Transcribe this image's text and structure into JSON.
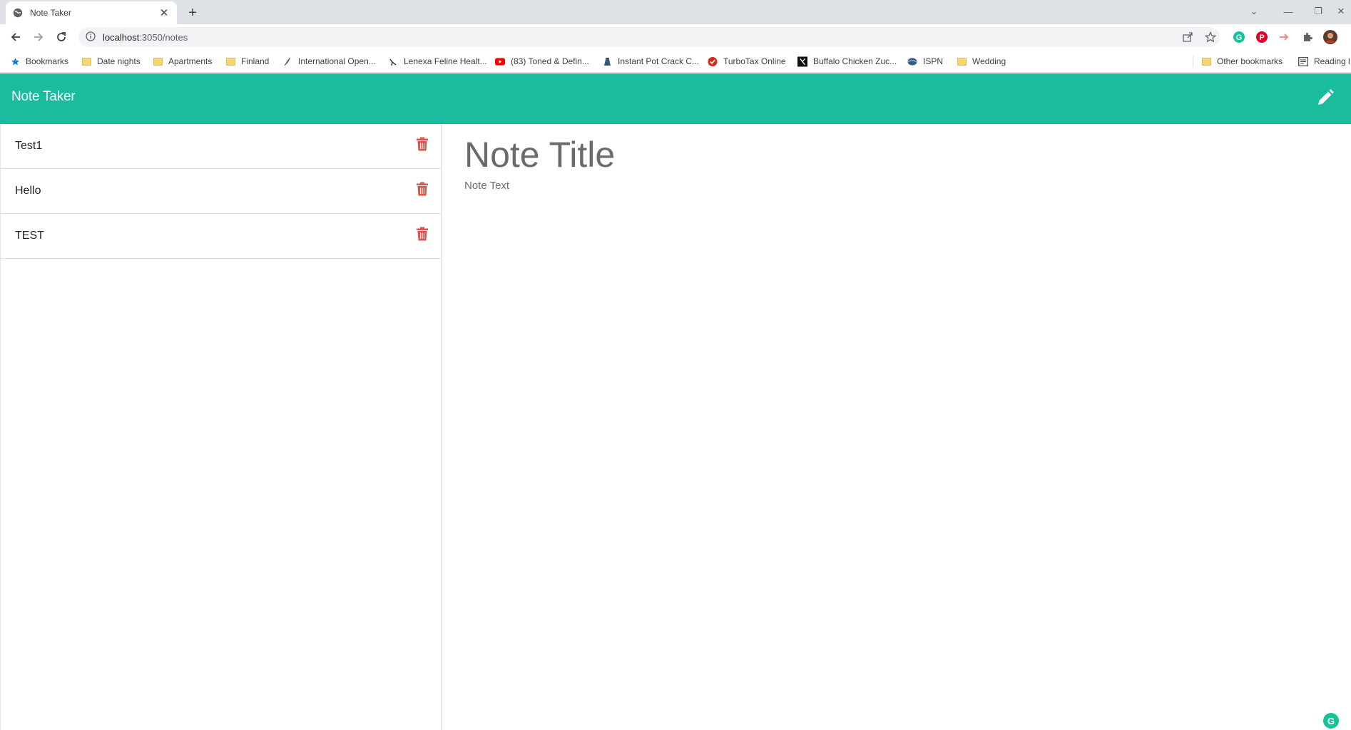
{
  "browser": {
    "tab": {
      "title": "Note Taker"
    },
    "address": {
      "host": "localhost",
      "path": ":3050/notes"
    },
    "bookmarks": [
      {
        "label": "Bookmarks",
        "icon": "star-icon"
      },
      {
        "label": "Date nights",
        "icon": "folder-icon"
      },
      {
        "label": "Apartments",
        "icon": "folder-icon"
      },
      {
        "label": "Finland",
        "icon": "folder-icon"
      },
      {
        "label": "International Open...",
        "icon": "feather-icon"
      },
      {
        "label": "Lenexa Feline Healt...",
        "icon": "cat-icon"
      },
      {
        "label": "(83) Toned & Defin...",
        "icon": "youtube-icon"
      },
      {
        "label": "Instant Pot Crack C...",
        "icon": "pot-icon"
      },
      {
        "label": "TurboTax Online",
        "icon": "turbotax-icon"
      },
      {
        "label": "Buffalo Chicken Zuc...",
        "icon": "site-icon"
      },
      {
        "label": "ISPN",
        "icon": "globe-icon"
      },
      {
        "label": "Wedding",
        "icon": "folder-icon"
      }
    ],
    "other_bookmarks": "Other bookmarks",
    "reading_list": "Reading l"
  },
  "app": {
    "brand": "Note Taker",
    "notes": [
      {
        "title": "Test1"
      },
      {
        "title": "Hello"
      },
      {
        "title": "TEST"
      }
    ],
    "editor": {
      "title_placeholder": "Note Title",
      "text_placeholder": "Note Text"
    }
  },
  "colors": {
    "accent": "#19bc9c",
    "delete": "#d9534f"
  }
}
